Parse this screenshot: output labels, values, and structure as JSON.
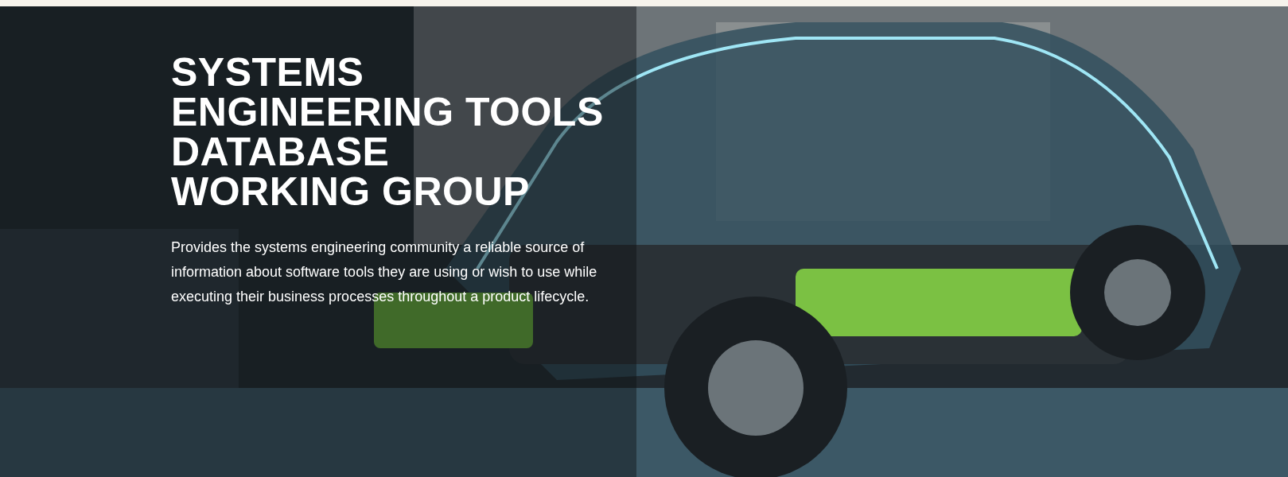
{
  "hero": {
    "title_lines": [
      "SYSTEMS",
      "ENGINEERING TOOLS",
      "DATABASE",
      "WORKING GROUP"
    ],
    "description": "Provides the systems engineering community a reliable source of information about software tools they are using or wish to use while executing their business processes throughout a product lifecycle."
  }
}
